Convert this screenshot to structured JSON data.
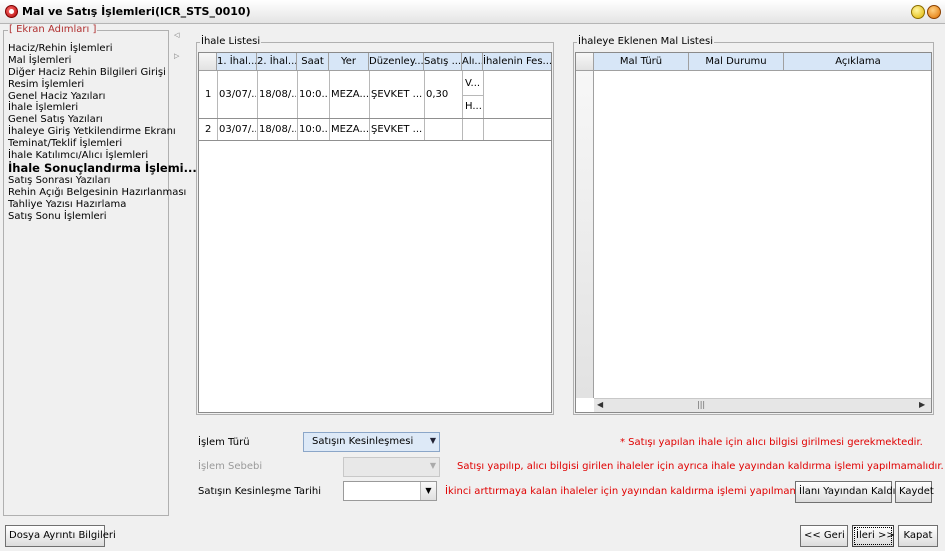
{
  "window": {
    "title": "Mal ve Satış İşlemleri(ICR_STS_0010)"
  },
  "steps": {
    "legend": "[ Ekran Adımları ]",
    "items": [
      "Haciz/Rehin İşlemleri",
      "Mal İşlemleri",
      "Diğer Haciz Rehin Bilgileri Girişi",
      "Resim İşlemleri",
      "Genel Haciz Yazıları",
      "İhale İşlemleri",
      "Genel Satış Yazıları",
      "İhaleye Giriş Yetkilendirme Ekranı",
      "Teminat/Teklif İşlemleri",
      "İhale Katılımcı/Alıcı İşlemleri",
      "İhale Sonuçlandırma İşlemi...",
      "Satış Sonrası Yazıları",
      "Rehin Açığı Belgesinin Hazırlanması",
      "Tahliye Yazısı Hazırlama",
      "Satış Sonu İşlemleri"
    ],
    "active_index": 10
  },
  "ihale_listesi": {
    "legend": "İhale Listesi",
    "columns": [
      "1. İhal...",
      "2. İhal...",
      "Saat",
      "Yer",
      "Düzenley...",
      "Satış ...",
      "Alı...",
      "İhalenin Fes..."
    ],
    "rows": [
      {
        "no": "1",
        "ihale1": "03/07/...",
        "ihale2": "18/08/...",
        "saat": "10:0...",
        "yer": "MEZA...",
        "duzenleyen": "ŞEVKET ...",
        "satis": "0,30",
        "alici": [
          "V...",
          "H..."
        ],
        "fesih": ""
      },
      {
        "no": "2",
        "ihale1": "03/07/...",
        "ihale2": "18/08/...",
        "saat": "10:0...",
        "yer": "MEZA...",
        "duzenleyen": "ŞEVKET ...",
        "satis": "",
        "alici": [
          ""
        ],
        "fesih": ""
      }
    ]
  },
  "mal_listesi": {
    "legend": "İhaleye Eklenen Mal Listesi",
    "columns": [
      "Mal Türü",
      "Mal Durumu",
      "Açıklama"
    ],
    "scroll_grip": "|||"
  },
  "form": {
    "islem_turu_label": "İşlem Türü",
    "islem_turu_value": "Satışın Kesinleşmesi",
    "islem_sebebi_label": "İşlem Sebebi",
    "islem_sebebi_value": "",
    "tarih_label": "Satışın Kesinleşme Tarihi",
    "tarih_value": ""
  },
  "messages": [
    "* Satışı yapılan ihale için alıcı bilgisi girilmesi gerekmektedir.",
    "Satışı yapılıp, alıcı bilgisi girilen ihaleler için ayrıca ihale yayından kaldırma işlemi yapılmamalıdır.",
    "İkinci arttırmaya kalan ihaleler için yayından kaldırma işlemi yapılmamalıdır."
  ],
  "buttons": {
    "yayindan_kaldir": "İlanı Yayından Kaldır",
    "kaydet": "Kaydet",
    "dosya_ayrinti": "Dosya Ayrıntı Bilgileri",
    "geri": "<< Geri",
    "ileri": "İleri >>",
    "kapat": "Kapat"
  },
  "colors": {
    "message_red": "#e00000",
    "legend_red": "#b03030",
    "header_blue": "#d7e6f7"
  }
}
